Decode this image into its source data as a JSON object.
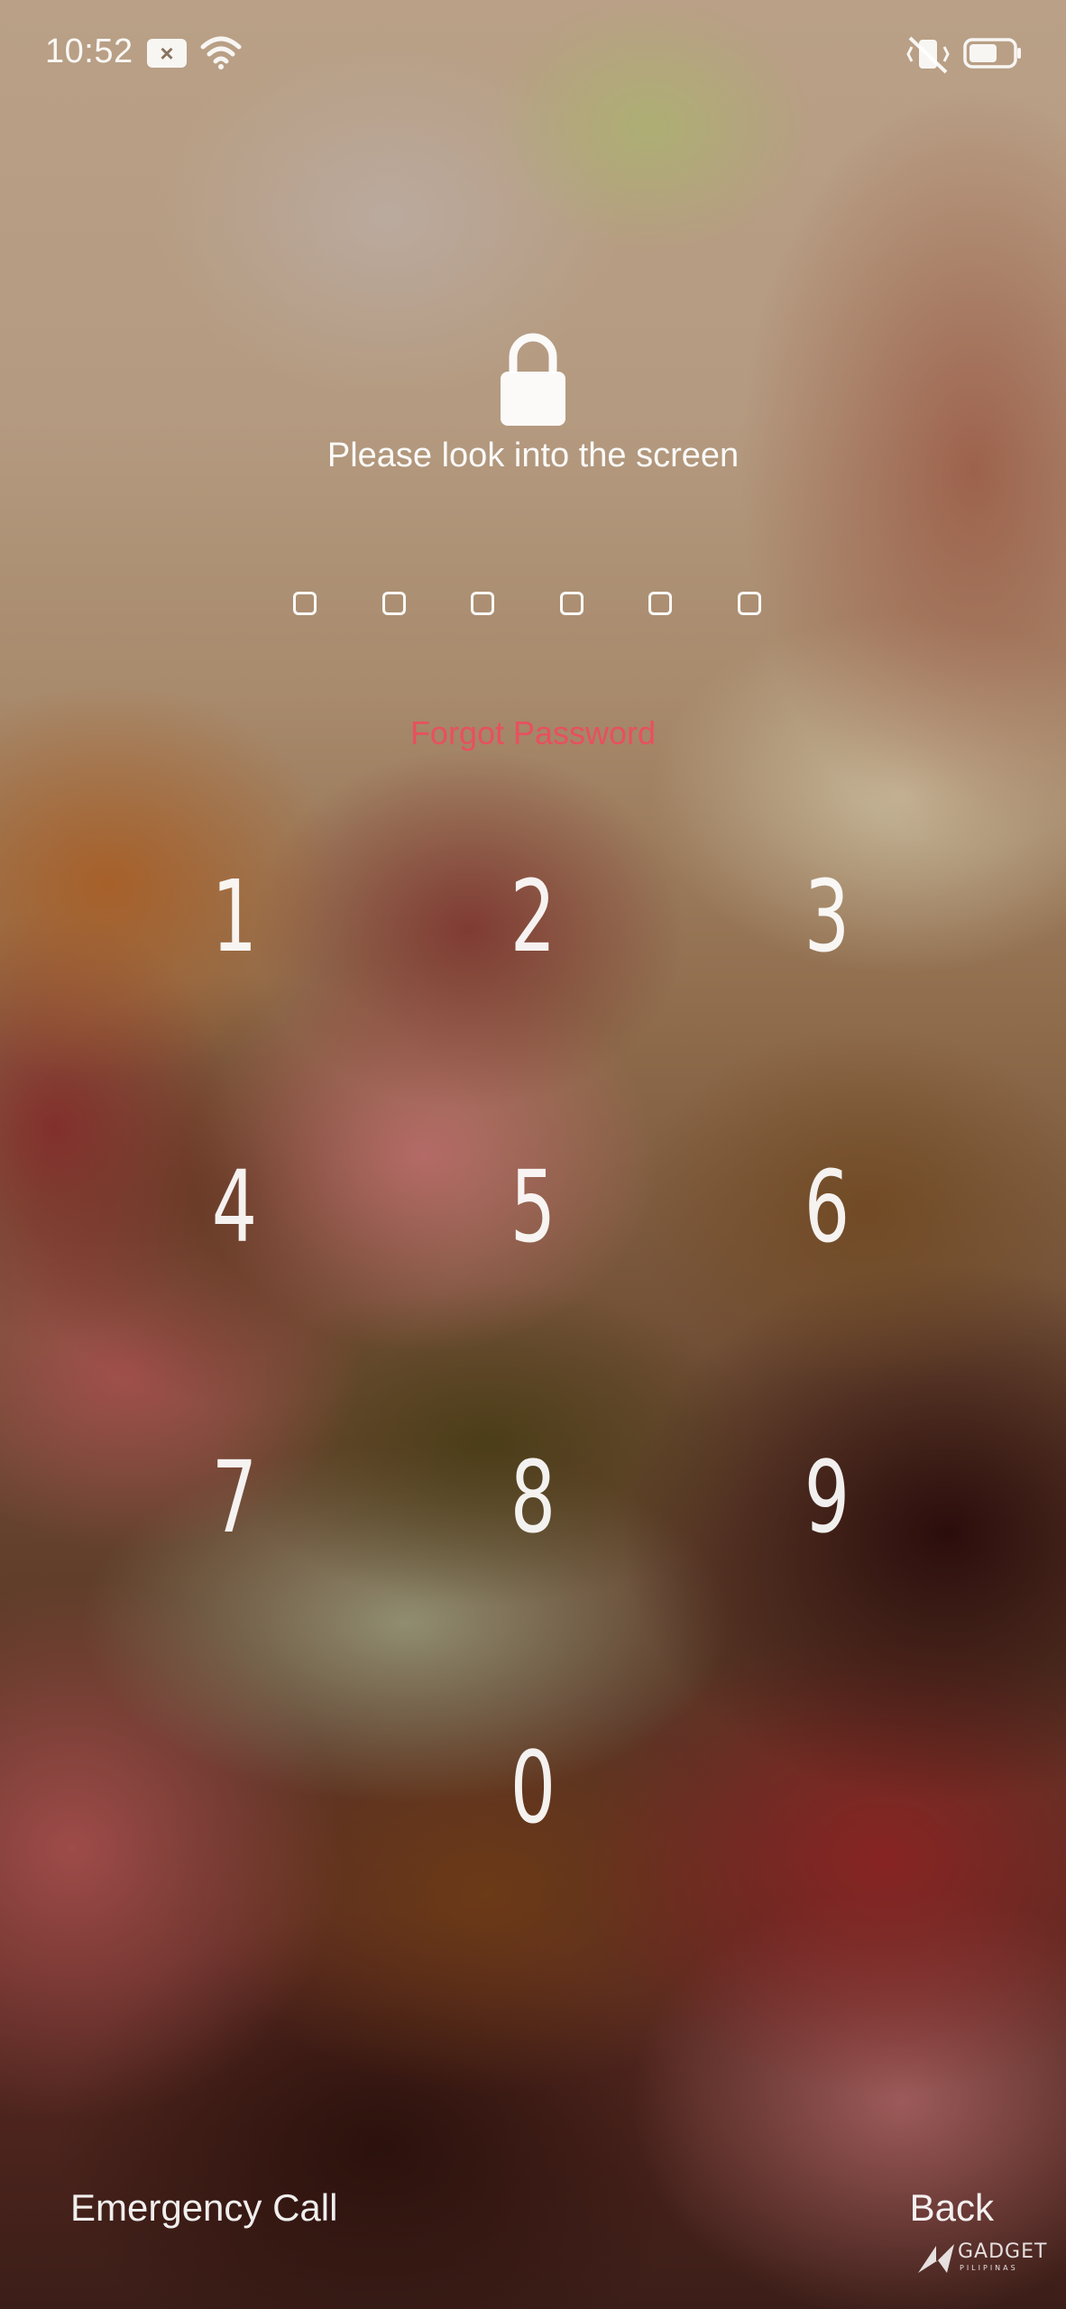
{
  "status_bar": {
    "time": "10:52",
    "icons": [
      "notification-icon",
      "wifi-icon",
      "vibrate-off-icon",
      "battery-icon"
    ]
  },
  "lock": {
    "icon": "lock-icon",
    "prompt": "Please look into the screen"
  },
  "pin": {
    "length": 6,
    "entered": 0
  },
  "forgot_password": "Forgot Password",
  "keypad": {
    "keys": [
      "1",
      "2",
      "3",
      "4",
      "5",
      "6",
      "7",
      "8",
      "9",
      "0"
    ]
  },
  "bottom": {
    "emergency_call": "Emergency Call",
    "back": "Back"
  },
  "watermark": {
    "name": "GADGET",
    "sub": "PILIPINAS"
  },
  "colors": {
    "forgot_password": "#e8505e",
    "text": "#ffffff"
  }
}
